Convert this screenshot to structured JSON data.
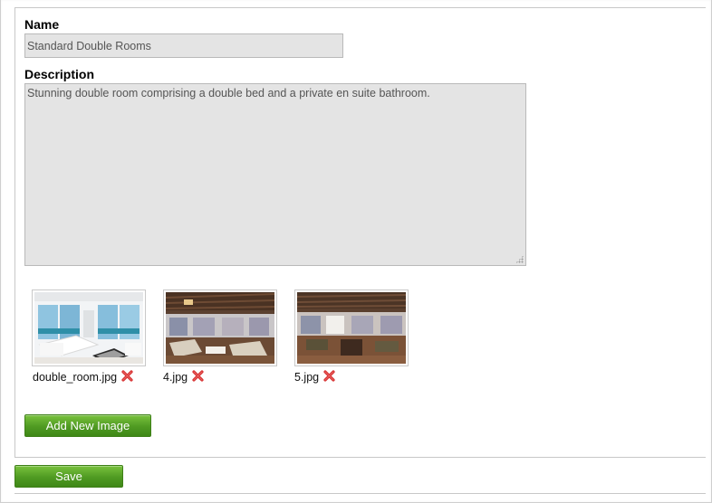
{
  "form": {
    "name_label": "Name",
    "name_value": "Standard Double Rooms",
    "description_label": "Description",
    "description_value": "Stunning double room comprising a double bed and a private en suite bathroom."
  },
  "images": [
    {
      "filename": "double_room.jpg",
      "delete_icon": "delete-x-icon"
    },
    {
      "filename": "4.jpg",
      "delete_icon": "delete-x-icon"
    },
    {
      "filename": "5.jpg",
      "delete_icon": "delete-x-icon"
    }
  ],
  "buttons": {
    "add_image_label": "Add New Image",
    "save_label": "Save"
  },
  "colors": {
    "button_green": "#4f9a22",
    "field_bg": "#e4e4e4",
    "delete_red": "#d62f2f"
  }
}
